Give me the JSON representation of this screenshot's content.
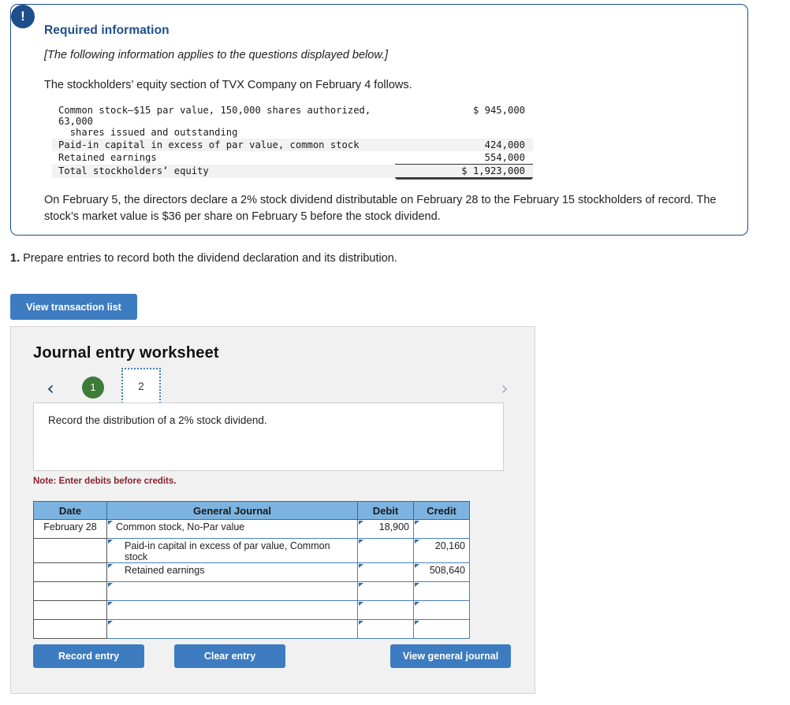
{
  "info_box": {
    "badge_icon": "exclamation-icon",
    "title": "Required information",
    "italic_note": "[The following information applies to the questions displayed below.]",
    "lead": "The stockholders’ equity section of TVX Company on February 4 follows.",
    "equity_table": {
      "rows": [
        {
          "label": "Common stock—$15 par value, 150,000 shares authorized, 63,000\n  shares issued and outstanding",
          "amount": "$ 945,000",
          "shaded": false
        },
        {
          "label": "Paid-in capital in excess of par value, common stock",
          "amount": "424,000",
          "shaded": true
        },
        {
          "label": "Retained earnings",
          "amount": "554,000",
          "shaded": false
        },
        {
          "label": "Total stockholders’ equity",
          "amount": "$ 1,923,000",
          "shaded": true
        }
      ]
    },
    "tail": "On February 5, the directors declare a 2% stock dividend distributable on February 28 to the February 15 stockholders of record. The stock’s market value is $36 per share on February 5 before the stock dividend."
  },
  "question": {
    "number": "1.",
    "text": " Prepare entries to record both the dividend declaration and its distribution."
  },
  "buttons": {
    "view_transaction_list": "View transaction list",
    "record_entry": "Record entry",
    "clear_entry": "Clear entry",
    "view_general_journal": "View general journal"
  },
  "worksheet": {
    "title": "Journal entry worksheet",
    "tabs": {
      "prev_icon": "‹",
      "next_icon": "›",
      "items": [
        {
          "label": "1",
          "state": "completed"
        },
        {
          "label": "2",
          "state": "active"
        }
      ]
    },
    "description": "Record the distribution of a 2% stock dividend.",
    "note": "Note: Enter debits before credits.",
    "table": {
      "headers": [
        "Date",
        "General Journal",
        "Debit",
        "Credit"
      ],
      "rows": [
        {
          "date": "February 28",
          "account": "Common stock, No-Par value",
          "indent": false,
          "debit": "18,900",
          "credit": ""
        },
        {
          "date": "",
          "account": "Paid-in capital in excess of par value, Common stock",
          "indent": true,
          "debit": "",
          "credit": "20,160"
        },
        {
          "date": "",
          "account": "Retained earnings",
          "indent": true,
          "debit": "",
          "credit": "508,640"
        },
        {
          "date": "",
          "account": "",
          "indent": false,
          "debit": "",
          "credit": ""
        },
        {
          "date": "",
          "account": "",
          "indent": false,
          "debit": "",
          "credit": ""
        },
        {
          "date": "",
          "account": "",
          "indent": false,
          "debit": "",
          "credit": ""
        }
      ]
    }
  },
  "colors": {
    "brand_blue": "#3d7cc0",
    "navy": "#1c4f8b",
    "header_blue": "#7cb3e0",
    "green": "#3f7a39",
    "note_red": "#8a2230",
    "panel_bg": "#f1f1f1"
  }
}
